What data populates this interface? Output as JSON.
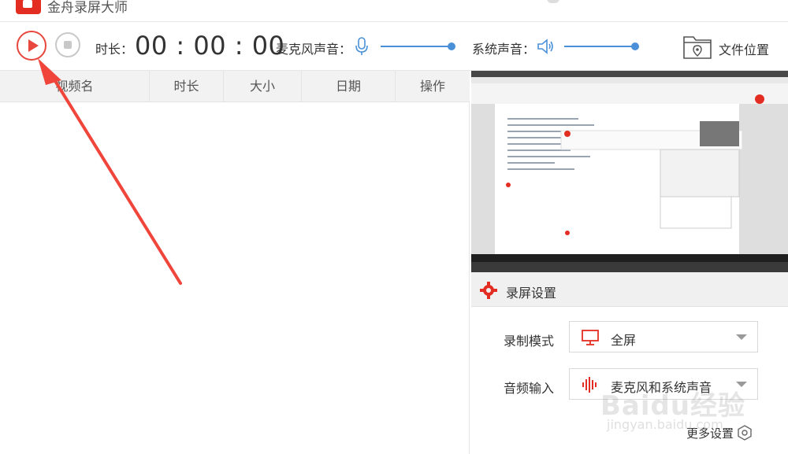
{
  "app": {
    "title": "金舟录屏大师"
  },
  "toolbar": {
    "duration_label": "时长：",
    "timer": "00 : 00 : 00",
    "mic_label": "麦克风声音：",
    "system_label": "系统声音：",
    "folder_label": "文件位置",
    "mic_volume": 1.0,
    "system_volume": 1.0
  },
  "list": {
    "columns": [
      "视频名",
      "时长",
      "大小",
      "日期",
      "操作"
    ],
    "rows": []
  },
  "settings": {
    "title": "录屏设置",
    "mode_label": "录制模式",
    "mode_value": "全屏",
    "audio_label": "音频输入",
    "audio_value": "麦克风和系统声音",
    "more_label": "更多设置"
  },
  "watermark": {
    "line1": "Baidu经验",
    "line2": "jingyan.baidu.com"
  },
  "colors": {
    "accent": "#e8473d",
    "slider": "#4a90d9",
    "header_bg": "#f2f2f2"
  },
  "icons": [
    "record-icon",
    "stop-icon",
    "microphone-icon",
    "speaker-icon",
    "folder-location-icon",
    "gear-icon",
    "monitor-icon",
    "audio-wave-icon",
    "settings-icon"
  ]
}
